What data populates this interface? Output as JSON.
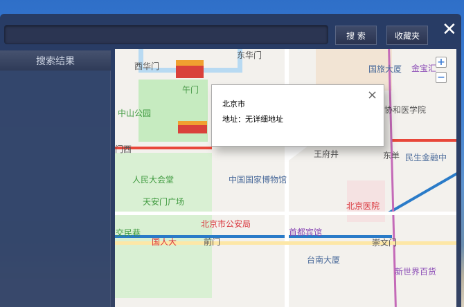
{
  "toolbar": {
    "search_value": "",
    "search_label": "搜 索",
    "favorites_label": "收藏夹",
    "close_label": "✕"
  },
  "sidebar": {
    "title": "搜索结果"
  },
  "popup": {
    "title": "北京市",
    "address": "地址：无详细地址",
    "close_label": "×"
  },
  "map": {
    "zoom_in": "+",
    "zoom_out": "−",
    "labels": [
      {
        "t": "西华门",
        "c": "#555"
      },
      {
        "t": "东华门",
        "c": "#555"
      },
      {
        "t": "午门",
        "c": "#4a9a4a"
      },
      {
        "t": "中山公园",
        "c": "#3f9a3f"
      },
      {
        "t": "国旅大厦",
        "c": "#4a6a9a"
      },
      {
        "t": "金宝汇",
        "c": "#8a4ab5"
      },
      {
        "t": "协和医学院",
        "c": "#555"
      },
      {
        "t": "东单",
        "c": "#555"
      },
      {
        "t": "民生金融中",
        "c": "#4a6a9a"
      },
      {
        "t": "王府井",
        "c": "#555"
      },
      {
        "t": "中国国家博物馆",
        "c": "#4a6a9a"
      },
      {
        "t": "人民大会堂",
        "c": "#3f9a3f"
      },
      {
        "t": "天安门广场",
        "c": "#3f9a3f"
      },
      {
        "t": "北京医院",
        "c": "#d9343a"
      },
      {
        "t": "北京市公安局",
        "c": "#d9343a"
      },
      {
        "t": "首都宾馆",
        "c": "#8a4ab5"
      },
      {
        "t": "交民巷",
        "c": "#3f9a3f"
      },
      {
        "t": "国人大",
        "c": "#d9343a"
      },
      {
        "t": "前门",
        "c": "#555"
      },
      {
        "t": "崇文门",
        "c": "#555"
      },
      {
        "t": "台南大厦",
        "c": "#4a6a9a"
      },
      {
        "t": "新世界百货",
        "c": "#8a4ab5"
      },
      {
        "t": "门西",
        "c": "#555"
      }
    ]
  }
}
